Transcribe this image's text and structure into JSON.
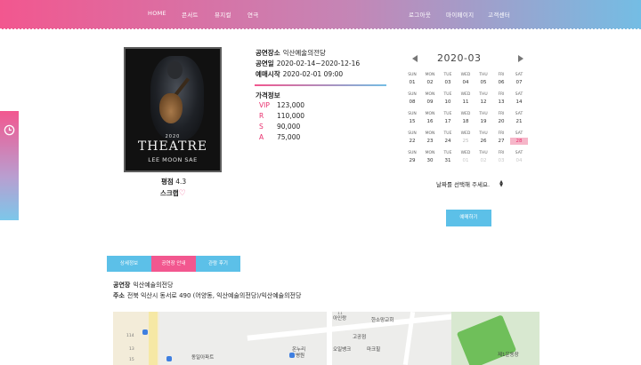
{
  "nav": {
    "left_items": [
      "HOME",
      "콘서트",
      "뮤지컬",
      "연극"
    ],
    "right_items": [
      "로그아웃",
      "마이페이지",
      "고객센터"
    ]
  },
  "side_tab": {
    "icon": "clock-icon"
  },
  "poster": {
    "year": "2020",
    "title": "THEATRE",
    "artist": "LEE MOON SAE"
  },
  "rating": {
    "label": "평점",
    "value": "4.3"
  },
  "scrap": {
    "label": "스크랩",
    "icon": "heart-icon",
    "icon_glyph": "♡"
  },
  "info": {
    "venue_label": "공연장소",
    "venue": "익산예술의전당",
    "date_label": "공연일",
    "date": "2020-02-14~2020-12-16",
    "open_label": "예매시작",
    "open": "2020-02-01 09:00",
    "price_title": "가격정보",
    "prices": [
      {
        "grade": "VIP",
        "price": "123,000"
      },
      {
        "grade": "R",
        "price": "110,000"
      },
      {
        "grade": "S",
        "price": "90,000"
      },
      {
        "grade": "A",
        "price": "75,000"
      }
    ]
  },
  "calendar": {
    "title": "2020-03",
    "weeks": [
      {
        "days": [
          "01",
          "02",
          "03",
          "04",
          "05",
          "06",
          "07"
        ]
      },
      {
        "days": [
          "08",
          "09",
          "10",
          "11",
          "12",
          "13",
          "14"
        ]
      },
      {
        "days": [
          "15",
          "16",
          "17",
          "18",
          "19",
          "20",
          "21"
        ]
      },
      {
        "days": [
          "22",
          "23",
          "24",
          "25",
          "26",
          "27",
          "28"
        ]
      },
      {
        "days": [
          "29",
          "30",
          "31",
          "01",
          "02",
          "03",
          "04"
        ]
      }
    ],
    "dow": [
      "SUN",
      "MON",
      "TUE",
      "WED",
      "THU",
      "FRI",
      "SAT"
    ],
    "selected": "28",
    "colors": {
      "selected_bg": "#f6b6c9",
      "accent": "#e9306e"
    }
  },
  "date_select": {
    "placeholder": "날짜를 선택해 주세요."
  },
  "reserve_button": "예매하기",
  "tabs": [
    {
      "label": "상세정보",
      "color": "#5cc0e8"
    },
    {
      "label": "공연장 안내",
      "color": "#f2578f"
    },
    {
      "label": "관람 후기",
      "color": "#5cc0e8"
    }
  ],
  "venue_info": {
    "name_label": "공연장",
    "name": "익산예술의전당",
    "addr_label": "주소",
    "address": "전북 익산시 동서로 490 (어양동, 익산예술의전당)/익산예술의전당"
  },
  "map": {
    "labels": [
      "아인랑",
      "한소망교회",
      "고공점",
      "오일뱅크",
      "마크힐",
      "온누리",
      "병원",
      "동일아파트",
      "제1운동장",
      "11",
      "114",
      "13",
      "15"
    ]
  },
  "colors": {
    "brand_pink": "#f2578f",
    "brand_blue": "#74bde4",
    "button_blue": "#5cc0e8"
  }
}
